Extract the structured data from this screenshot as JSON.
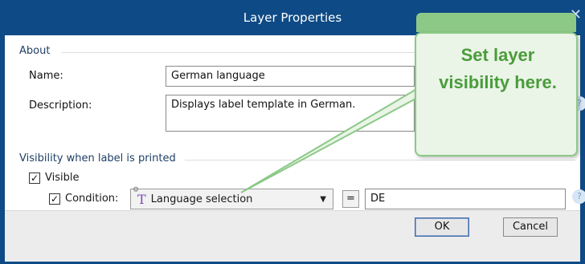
{
  "dialog": {
    "title": "Layer Properties",
    "close_glyph": "✕"
  },
  "about": {
    "group_label": "About",
    "name_label": "Name:",
    "name_value": "German language",
    "description_label": "Description:",
    "description_value": "Displays label template in German."
  },
  "visibility": {
    "group_label": "Visibility when label is printed",
    "visible_label": "Visible",
    "visible_checked": "✓",
    "condition_label": "Condition:",
    "condition_checked": "✓",
    "dropdown_value": "Language selection",
    "dropdown_icon": "variable-text-icon",
    "operator": "=",
    "compare_value": "DE"
  },
  "footer": {
    "ok_label": "OK",
    "cancel_label": "Cancel"
  },
  "callout": {
    "line1": "Set layer",
    "line2": "visibility here."
  },
  "colors": {
    "titlebar": "#0e4a85",
    "callout_fill": "#eaf4e7",
    "callout_border": "#8cc987",
    "callout_text": "#4a9c3b"
  }
}
